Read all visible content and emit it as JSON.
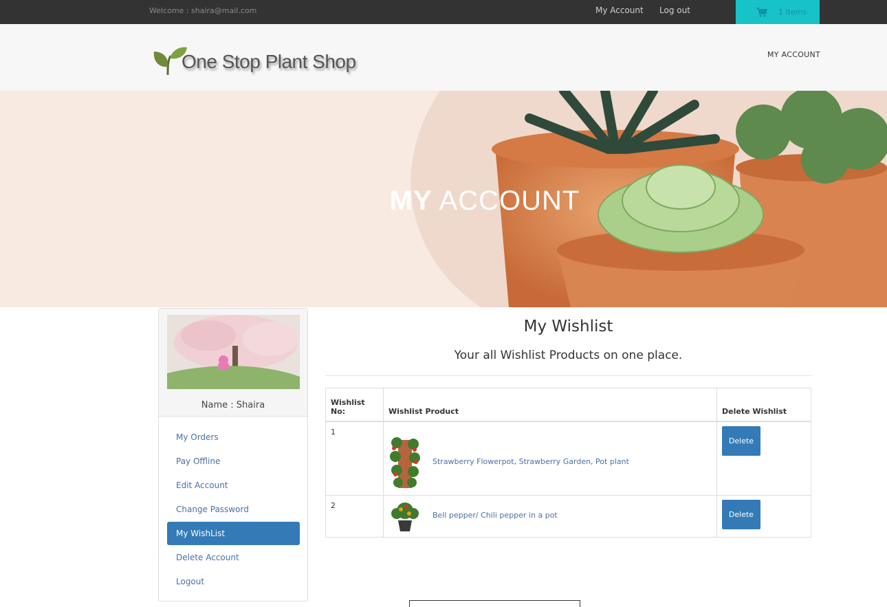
{
  "topbar": {
    "welcome": "Welcome : shaira@mail.com",
    "my_account": "My Account",
    "logout": "Log out",
    "cart_count": "1 items",
    "cart_color": "#17c3c7"
  },
  "header": {
    "logo_text": "One Stop Plant Shop",
    "nav_my_account": "MY ACCOUNT"
  },
  "banner": {
    "title_bold": "MY",
    "title_rest": "ACCOUNT"
  },
  "sidebar": {
    "name": "Name : Shaira",
    "items": [
      {
        "label": "My Orders"
      },
      {
        "label": "Pay Offline"
      },
      {
        "label": "Edit Account"
      },
      {
        "label": "Change Password"
      },
      {
        "label": "My WishList"
      },
      {
        "label": "Delete Account"
      },
      {
        "label": "Logout"
      }
    ],
    "active_index": 4
  },
  "main": {
    "title": "My Wishlist",
    "subtitle": "Your all Wishlist Products on one place.",
    "columns": [
      "Wishlist No:",
      "Wishlist Product",
      "Delete Wishlist"
    ],
    "rows": [
      {
        "no": "1",
        "product": "Strawberry Flowerpot, Strawberry Garden, Pot plant",
        "action": "Delete"
      },
      {
        "no": "2",
        "product": "Bell pepper/ Chili pepper in a pot",
        "action": "Delete"
      }
    ]
  },
  "colors": {
    "primary": "#337ab7",
    "topbar": "#333333",
    "link": "#4a6fa5"
  }
}
